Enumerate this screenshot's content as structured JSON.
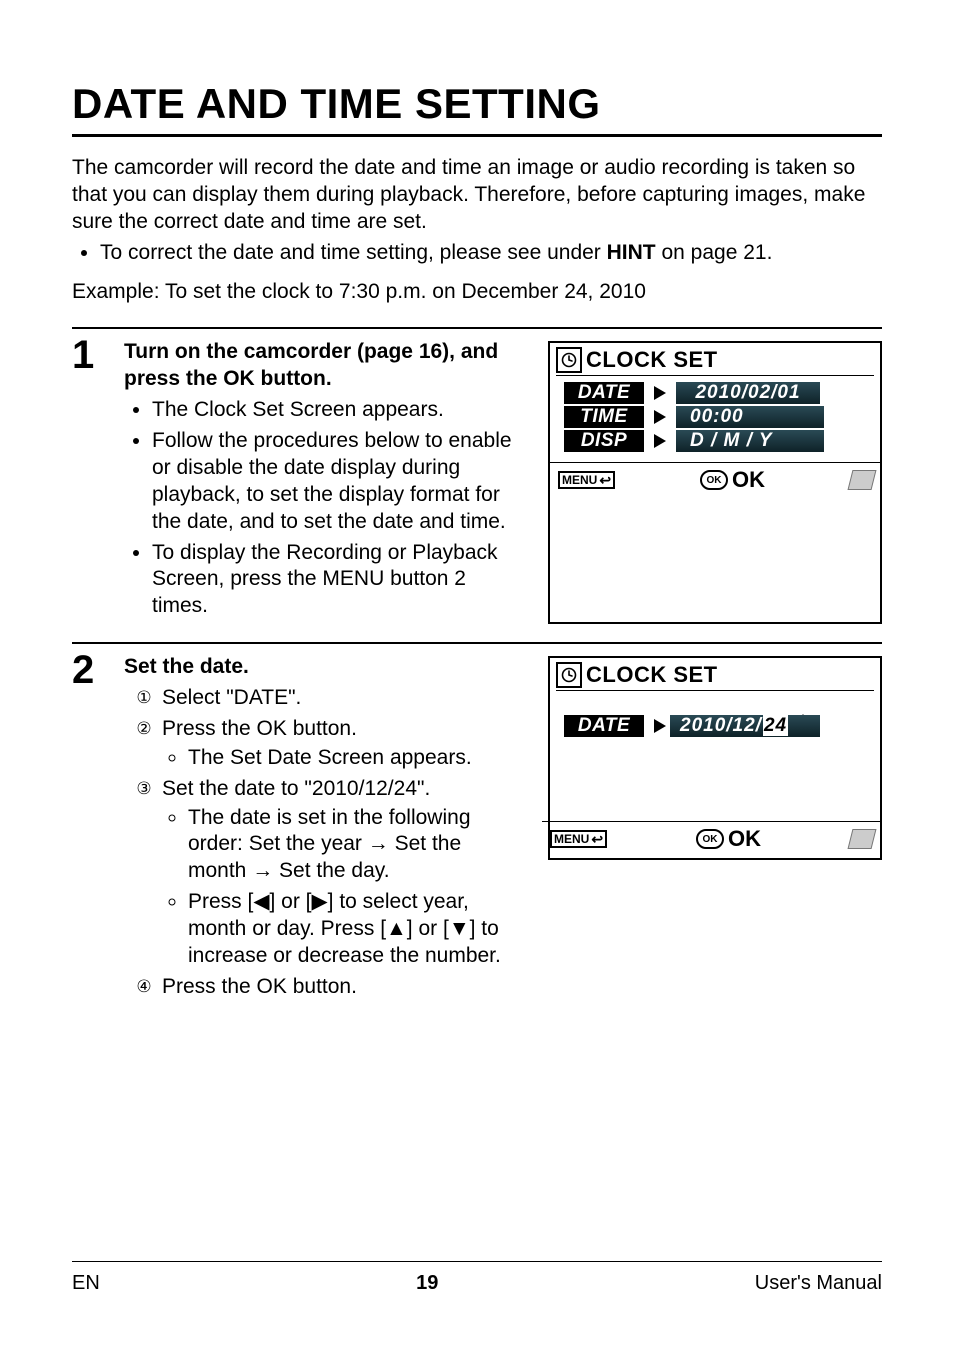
{
  "title": "DATE AND TIME SETTING",
  "intro": {
    "para": "The camcorder will record the date and time an image or audio recording is taken so that you can display them during playback. Therefore, before capturing images, make sure the correct date and time are set.",
    "bullet_prefix": "To correct the date and time setting, please see under ",
    "bullet_bold": "HINT",
    "bullet_suffix": " on page 21.",
    "example": "Example: To set the clock to 7:30 p.m. on December 24, 2010"
  },
  "step1": {
    "num": "1",
    "heading": "Turn on the camcorder (page 16), and press the OK button.",
    "b1": "The Clock Set Screen appears.",
    "b2": "Follow the procedures below to enable or disable the date display during playback, to set the display format for the date, and to set the date and time.",
    "b3": "To display the Recording or Playback Screen, press the MENU button 2 times.",
    "screen": {
      "title": "CLOCK SET",
      "row1_label": "DATE",
      "row1_value": "2010/02/01",
      "row2_label": "TIME",
      "row2_value": "00:00",
      "row3_label": "DISP",
      "row3_value": "D / M / Y",
      "menu": "MENU",
      "ok": "OK"
    }
  },
  "step2": {
    "num": "2",
    "heading": "Set the date.",
    "i1": "Select \"DATE\".",
    "i2": "Press the OK button.",
    "i2_sub": "The Set Date Screen appears.",
    "i3": "Set the date to \"2010/12/24\".",
    "i3_sub1": "The date is set in the following order: Set the year → Set the month → Set the day.",
    "i3_sub2": "Press [◀] or [▶] to select year, month or day. Press [▲] or [▼] to increase or decrease the number.",
    "i4": "Press the OK button.",
    "screen": {
      "title": "CLOCK SET",
      "row_label": "DATE",
      "row_value_prefix": "2010/12/",
      "row_value_highlight": "24",
      "menu": "MENU",
      "ok": "OK"
    }
  },
  "footer": {
    "left": "EN",
    "page": "19",
    "right": "User's Manual"
  }
}
